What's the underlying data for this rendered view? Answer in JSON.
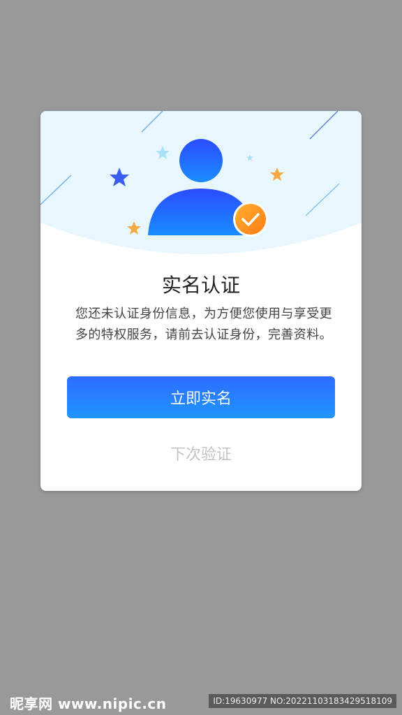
{
  "dialog": {
    "title": "实名认证",
    "description": "您还未认证身份信息，为方便您使用与享受更多的特权服务，请前去认证身份，完善资料。",
    "primary_button": "立即实名",
    "secondary_button": "下次验证"
  },
  "icons": {
    "avatar": "user-avatar-icon",
    "badge": "check-badge-icon",
    "stars": "star-icon"
  },
  "colors": {
    "backdrop": "#999999",
    "header_bg": "#e8f6fd",
    "avatar_top": "#2a4cff",
    "avatar_bottom": "#1a8cff",
    "badge": "#ff8c1a",
    "primary_button": "#2f6cff"
  },
  "watermark": {
    "logo": "昵享网 www.nipic.cn",
    "id": "ID:19630977 NO:20221103183429518109"
  }
}
